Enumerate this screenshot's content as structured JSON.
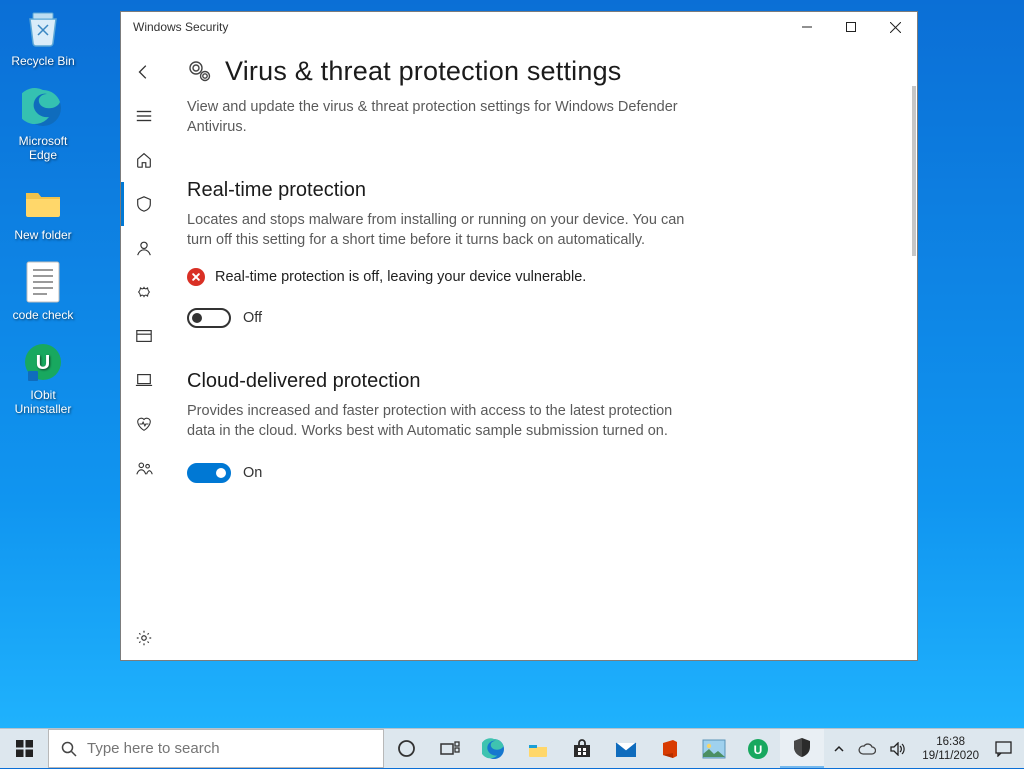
{
  "desktop": {
    "icons": [
      {
        "name": "Recycle Bin"
      },
      {
        "name": "Microsoft Edge"
      },
      {
        "name": "New folder"
      },
      {
        "name": "code check"
      },
      {
        "name": "IObit Uninstaller"
      }
    ]
  },
  "window": {
    "title": "Windows Security",
    "page": {
      "heading": "Virus & threat protection settings",
      "subheading": "View and update the virus & threat protection settings for Windows Defender Antivirus.",
      "sections": {
        "realtime": {
          "title": "Real-time protection",
          "desc": "Locates and stops malware from installing or running on your device. You can turn off this setting for a short time before it turns back on automatically.",
          "warning": "Real-time protection is off, leaving your device vulnerable.",
          "toggle_label": "Off",
          "toggle_on": false
        },
        "cloud": {
          "title": "Cloud-delivered protection",
          "desc": "Provides increased and faster protection with access to the latest protection data in the cloud. Works best with Automatic sample submission turned on.",
          "toggle_label": "On",
          "toggle_on": true
        }
      }
    }
  },
  "taskbar": {
    "search_placeholder": "Type here to search",
    "time": "16:38",
    "date": "19/11/2020"
  }
}
